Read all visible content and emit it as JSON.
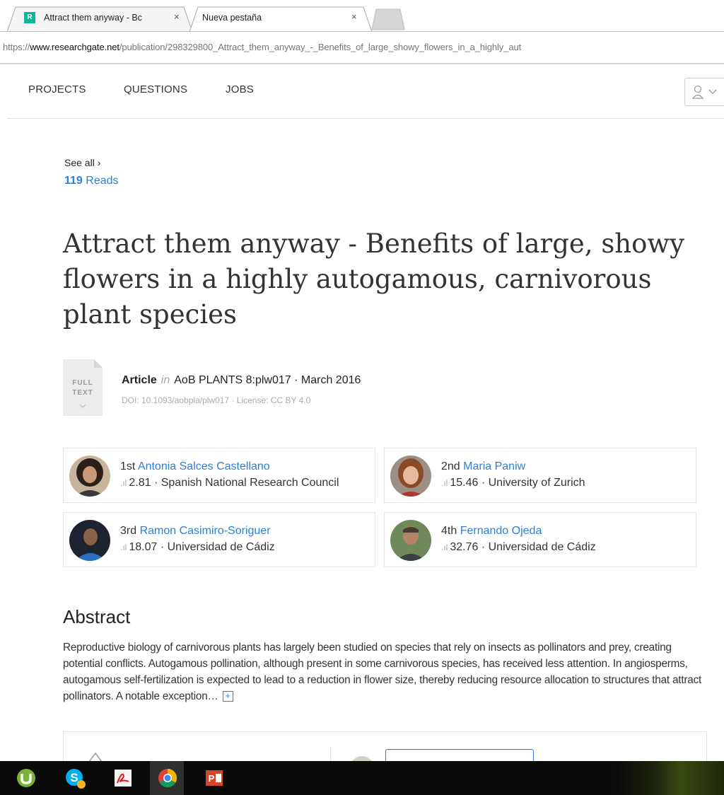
{
  "browser": {
    "tabs": [
      {
        "title": "Attract them anyway - Bc",
        "active": true
      },
      {
        "title": "Nueva pestaña",
        "active": false
      }
    ],
    "close_glyph": "×",
    "favicon_text": "R",
    "url_scheme": "https://",
    "url_host": "www.researchgate.net",
    "url_path": "/publication/298329800_Attract_them_anyway_-_Benefits_of_large_showy_flowers_in_a_highly_aut"
  },
  "nav": {
    "items": [
      "PROJECTS",
      "QUESTIONS",
      "JOBS"
    ],
    "account_icon": "user-icon"
  },
  "stats": {
    "see_all": "See all ›",
    "reads_count": "119",
    "reads_label": "Reads"
  },
  "publication": {
    "title": "Attract them anyway - Benefits of large, showy flowers in a highly autogamous, carnivorous plant species",
    "full_text_line1": "FULL",
    "full_text_line2": "TEXT",
    "type": "Article",
    "in_word": "in",
    "venue": "AoB PLANTS 8:plw017 · March 2016",
    "doi_license": "DOI: 10.1093/aobpla/plw017 · License: CC BY 4.0"
  },
  "authors": [
    {
      "order": "1st",
      "name": "Antonia Salces Castellano",
      "score": "2.81",
      "institution": "Spanish National Research Council"
    },
    {
      "order": "2nd",
      "name": "Maria Paniw",
      "score": "15.46",
      "institution": "University of Zurich"
    },
    {
      "order": "3rd",
      "name": "Ramon Casimiro-Soriguer",
      "score": "18.07",
      "institution": "Universidad de Cádiz"
    },
    {
      "order": "4th",
      "name": "Fernando Ojeda",
      "score": "32.76",
      "institution": "Universidad de Cádiz"
    }
  ],
  "score_separator": "·",
  "abstract": {
    "heading": "Abstract",
    "text": "Reproductive biology of carnivorous plants has largely been studied on species that rely on insects as pollinators and prey, creating potential conflicts. Autogamous pollination, although present in some carnivorous species, has received less attention. In angiosperms, autogamous self-fertilization is expected to lead to a reduction in flower size, thereby reducing resource allocation to structures that attract pollinators. A notable exception…",
    "expand_glyph": "+"
  },
  "taskbar": {
    "apps": [
      "utorrent-icon",
      "skype-icon",
      "acrobat-icon",
      "chrome-icon",
      "powerpoint-icon"
    ],
    "active": "chrome-icon"
  },
  "colors": {
    "link_blue": "#2b7fd8",
    "favicon_green": "#15b39a",
    "taskbar_bg": "#0a0a0a"
  }
}
